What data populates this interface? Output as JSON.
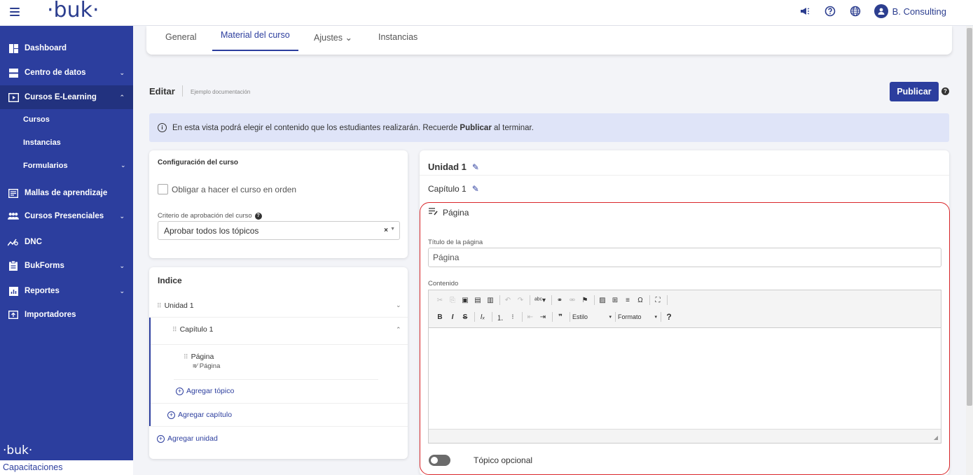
{
  "topbar": {
    "logo": "·buk·",
    "user_name": "B. Consulting"
  },
  "sidebar": {
    "items": [
      {
        "label": "Dashboard"
      },
      {
        "label": "Centro de datos"
      },
      {
        "label": "Cursos E-Learning"
      },
      {
        "label": "Mallas de aprendizaje"
      },
      {
        "label": "Cursos Presenciales"
      },
      {
        "label": "DNC"
      },
      {
        "label": "BukForms"
      },
      {
        "label": "Reportes"
      },
      {
        "label": "Importadores"
      }
    ],
    "sub_items": [
      {
        "label": "Cursos"
      },
      {
        "label": "Instancias"
      },
      {
        "label": "Formularios"
      }
    ],
    "footer_logo": "·buk·",
    "footer_text": "Capacitaciones"
  },
  "tabs": [
    {
      "label": "General"
    },
    {
      "label": "Material del curso"
    },
    {
      "label": "Ajustes ⌄"
    },
    {
      "label": "Instancias"
    }
  ],
  "header": {
    "title": "Editar",
    "subtitle": "Ejemplo documentación",
    "publish_label": "Publicar",
    "help": "?"
  },
  "info": {
    "text_before": "En esta vista podrá elegir el contenido que los estudiantes realizarán. Recuerde ",
    "bold": "Publicar",
    "text_after": " al terminar."
  },
  "config": {
    "title": "Configuración del curso",
    "checkbox_label": "Obligar a hacer el curso en orden",
    "criteria_label": "Criterio de aprobación del curso",
    "criteria_value": "Aprobar todos los tópicos",
    "clear": "×"
  },
  "index": {
    "title": "Indice",
    "unit": "Unidad 1",
    "chapter": "Capítulo 1",
    "page_title": "Página",
    "page_type": "Página",
    "add_topic": "Agregar tópico",
    "add_chapter": "Agregar capítulo",
    "add_unit": "Agregar unidad"
  },
  "editor": {
    "unit_title": "Unidad 1",
    "chapter_title": "Capítulo 1",
    "page_head": "Página",
    "page_title_label": "Título de la página",
    "page_title_value": "Página",
    "content_label": "Contenido",
    "style_combo": "Estilo",
    "format_combo": "Formato",
    "optional_label": "Tópico opcional"
  },
  "colors": {
    "primary": "#2c3e9e",
    "info_bg": "#dfe4f8",
    "highlight": "#d9262a"
  }
}
